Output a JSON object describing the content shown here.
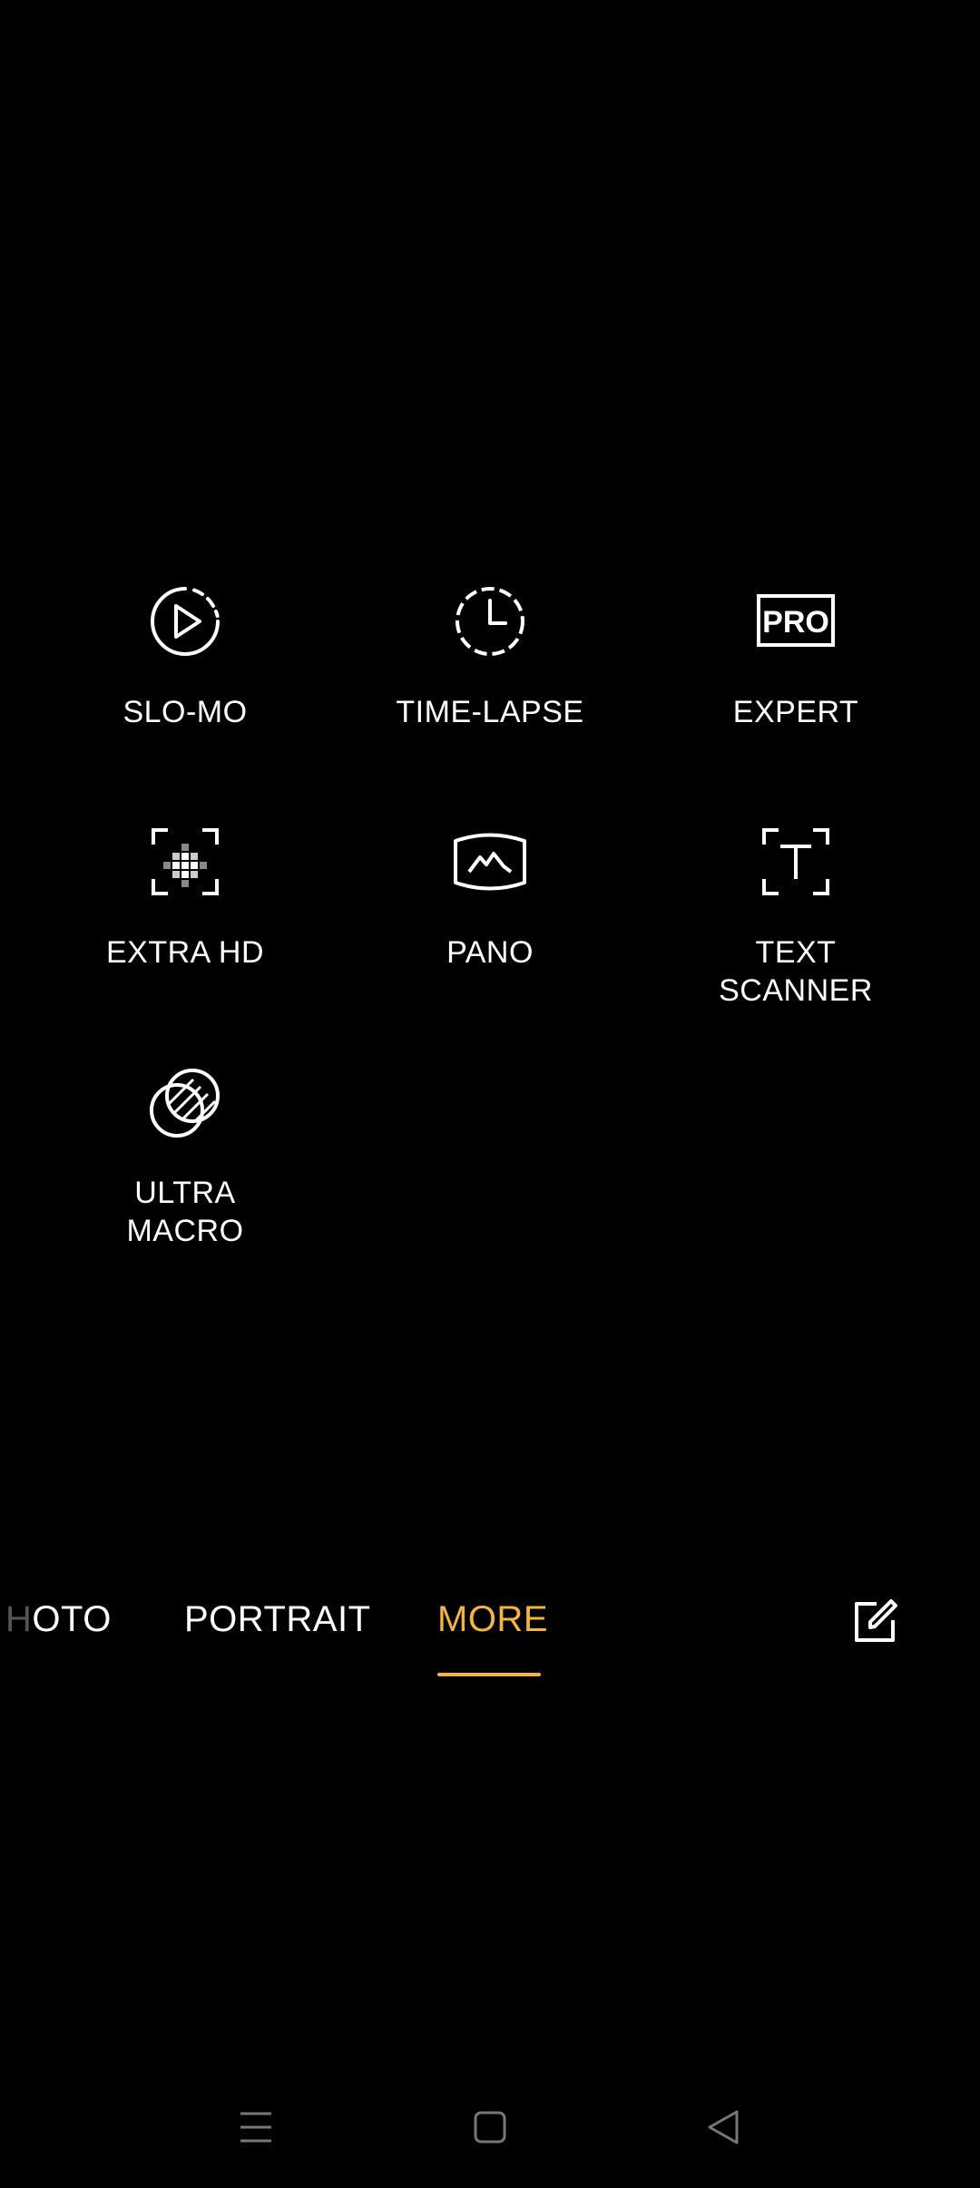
{
  "modes": [
    {
      "label": "SLO-MO",
      "icon": "slow-motion-icon"
    },
    {
      "label": "TIME-LAPSE",
      "icon": "time-lapse-icon"
    },
    {
      "label": "EXPERT",
      "icon": "pro-icon",
      "icon_text": "PRO"
    },
    {
      "label": "EXTRA HD",
      "icon": "extra-hd-icon"
    },
    {
      "label": "PANO",
      "icon": "panorama-icon"
    },
    {
      "label": "TEXT\nSCANNER",
      "icon": "text-scanner-icon",
      "icon_text": "T"
    },
    {
      "label": "ULTRA\nMACRO",
      "icon": "ultra-macro-icon"
    }
  ],
  "mode_bar": {
    "tabs": [
      {
        "label_faded": "H",
        "label": "OTO"
      },
      {
        "label": "PORTRAIT"
      },
      {
        "label": "MORE",
        "selected": true
      }
    ],
    "accent_color": "#f3b53f",
    "edit_icon": "edit-icon"
  },
  "nav_bar": {
    "menu_icon": "menu-icon",
    "home_icon": "home-icon",
    "back_icon": "back-icon"
  }
}
